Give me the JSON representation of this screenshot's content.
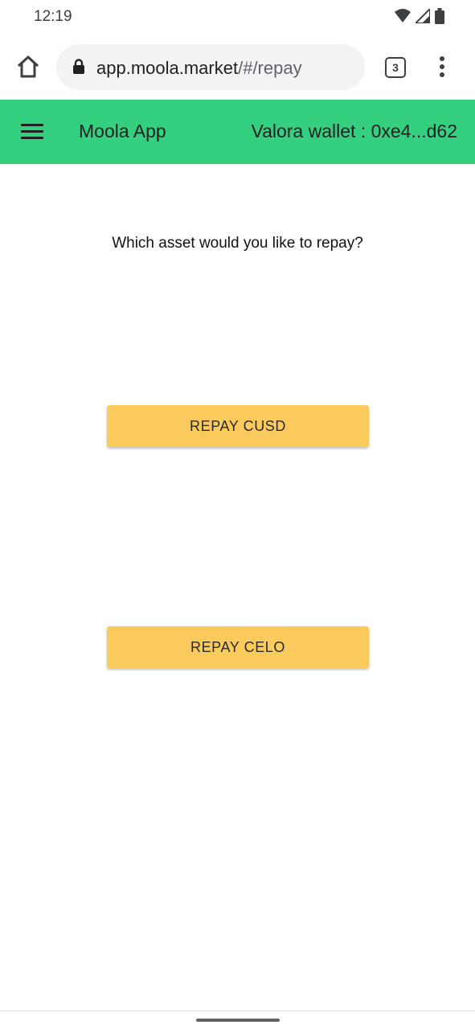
{
  "status_bar": {
    "time": "12:19",
    "icons": [
      "wifi-icon",
      "signal-icon",
      "battery-icon"
    ]
  },
  "browser": {
    "url_domain": "app.moola.market",
    "url_path": "/#/repay",
    "tab_count": "3",
    "icons": [
      "home-icon",
      "lock-icon",
      "tabs-icon",
      "more-vert-icon"
    ]
  },
  "app_header": {
    "title": "Moola App",
    "wallet": "Valora wallet : 0xe4...d62",
    "color": "#35d07f",
    "icons": [
      "menu-icon"
    ]
  },
  "main": {
    "question": "Which asset would you like to repay?",
    "buttons": [
      {
        "label": "REPAY CUSD"
      },
      {
        "label": "REPAY CELO"
      }
    ],
    "button_color": "#fbca5c"
  }
}
